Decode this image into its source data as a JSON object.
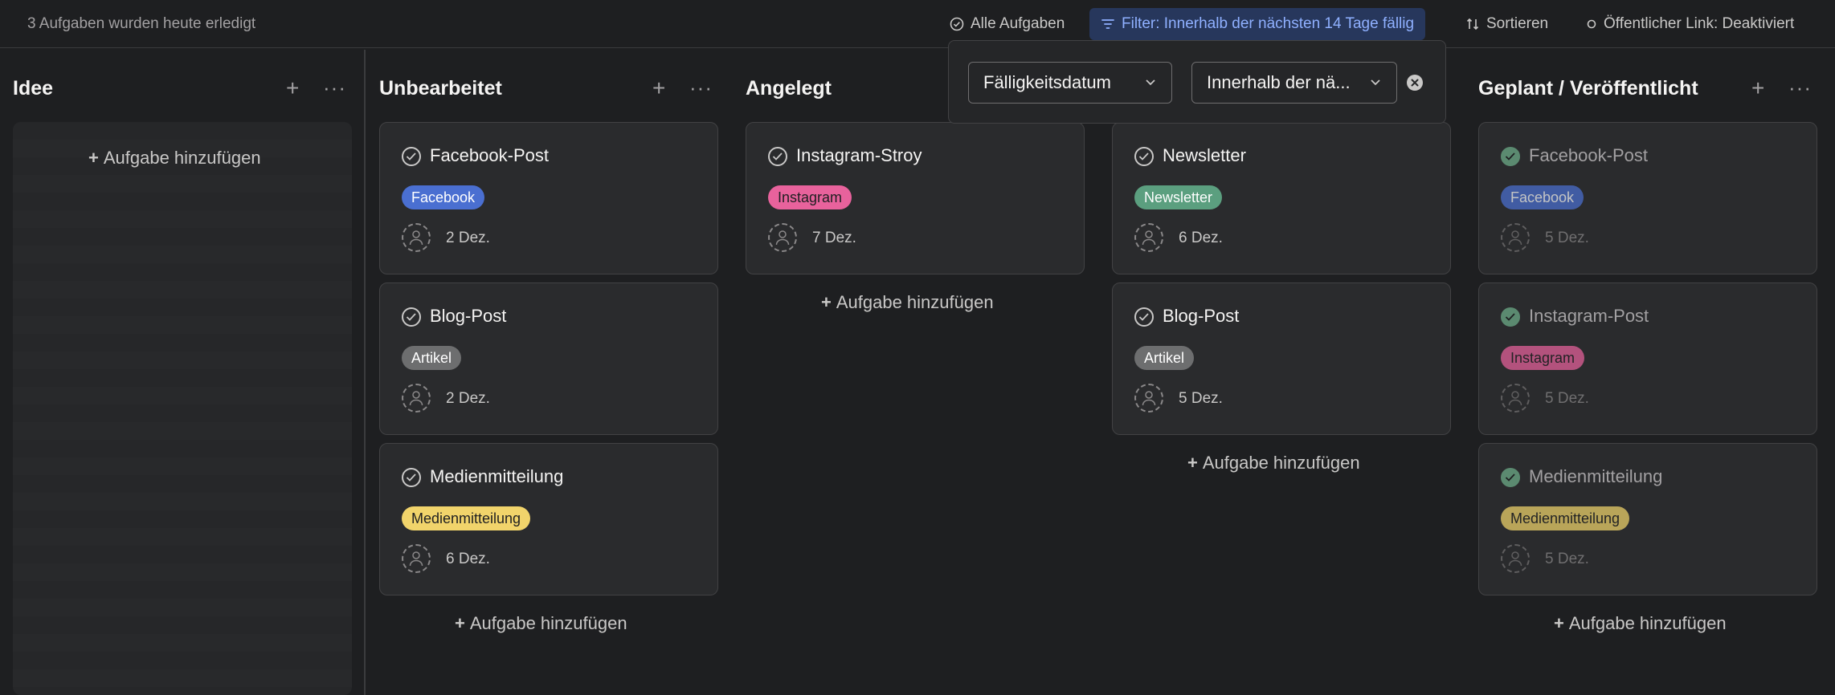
{
  "topbar": {
    "done_text": "3 Aufgaben wurden heute erledigt",
    "all_tasks": "Alle Aufgaben",
    "filter": "Filter: Innerhalb der nächsten 14 Tage fällig",
    "sort": "Sortieren",
    "public_link": "Öffentlicher Link: Deaktiviert"
  },
  "filter_popover": {
    "field": "Fälligkeitsdatum",
    "condition": "Innerhalb der nä...",
    "colors": {
      "accent": "#8fb0ff",
      "filter_bg": "#27375c"
    }
  },
  "add_task_label": "Aufgabe hinzufügen",
  "columns": [
    {
      "title": "Idee",
      "cards": []
    },
    {
      "title": "Unbearbeitet",
      "cards": [
        {
          "title": "Facebook-Post",
          "tag": "Facebook",
          "tag_color": "#4a6fd1",
          "due": "2 Dez.",
          "completed": false
        },
        {
          "title": "Blog-Post",
          "tag": "Artikel",
          "tag_color": "#6d6e6f",
          "due": "2 Dez.",
          "completed": false
        },
        {
          "title": "Medienmitteilung",
          "tag": "Medienmitteilung",
          "tag_color": "#f1d46b",
          "due": "6 Dez.",
          "completed": false
        }
      ]
    },
    {
      "title": "Angelegt",
      "cards": [
        {
          "title": "Instagram-Stroy",
          "tag": "Instagram",
          "tag_color": "#e8629c",
          "due": "7 Dez.",
          "completed": false
        }
      ]
    },
    {
      "title": "",
      "cards": [
        {
          "title": "Newsletter",
          "tag": "Newsletter",
          "tag_color": "#5b9f7f",
          "due": "6 Dez.",
          "completed": false
        },
        {
          "title": "Blog-Post",
          "tag": "Artikel",
          "tag_color": "#6d6e6f",
          "due": "5 Dez.",
          "completed": false
        }
      ]
    },
    {
      "title": "Geplant / Veröffentlicht",
      "cards": [
        {
          "title": "Facebook-Post",
          "tag": "Facebook",
          "tag_color": "#4a6fd1",
          "due": "5 Dez.",
          "completed": true
        },
        {
          "title": "Instagram-Post",
          "tag": "Instagram",
          "tag_color": "#e8629c",
          "due": "5 Dez.",
          "completed": true
        },
        {
          "title": "Medienmitteilung",
          "tag": "Medienmitteilung",
          "tag_color": "#f1d46b",
          "due": "5 Dez.",
          "completed": true
        }
      ]
    }
  ]
}
